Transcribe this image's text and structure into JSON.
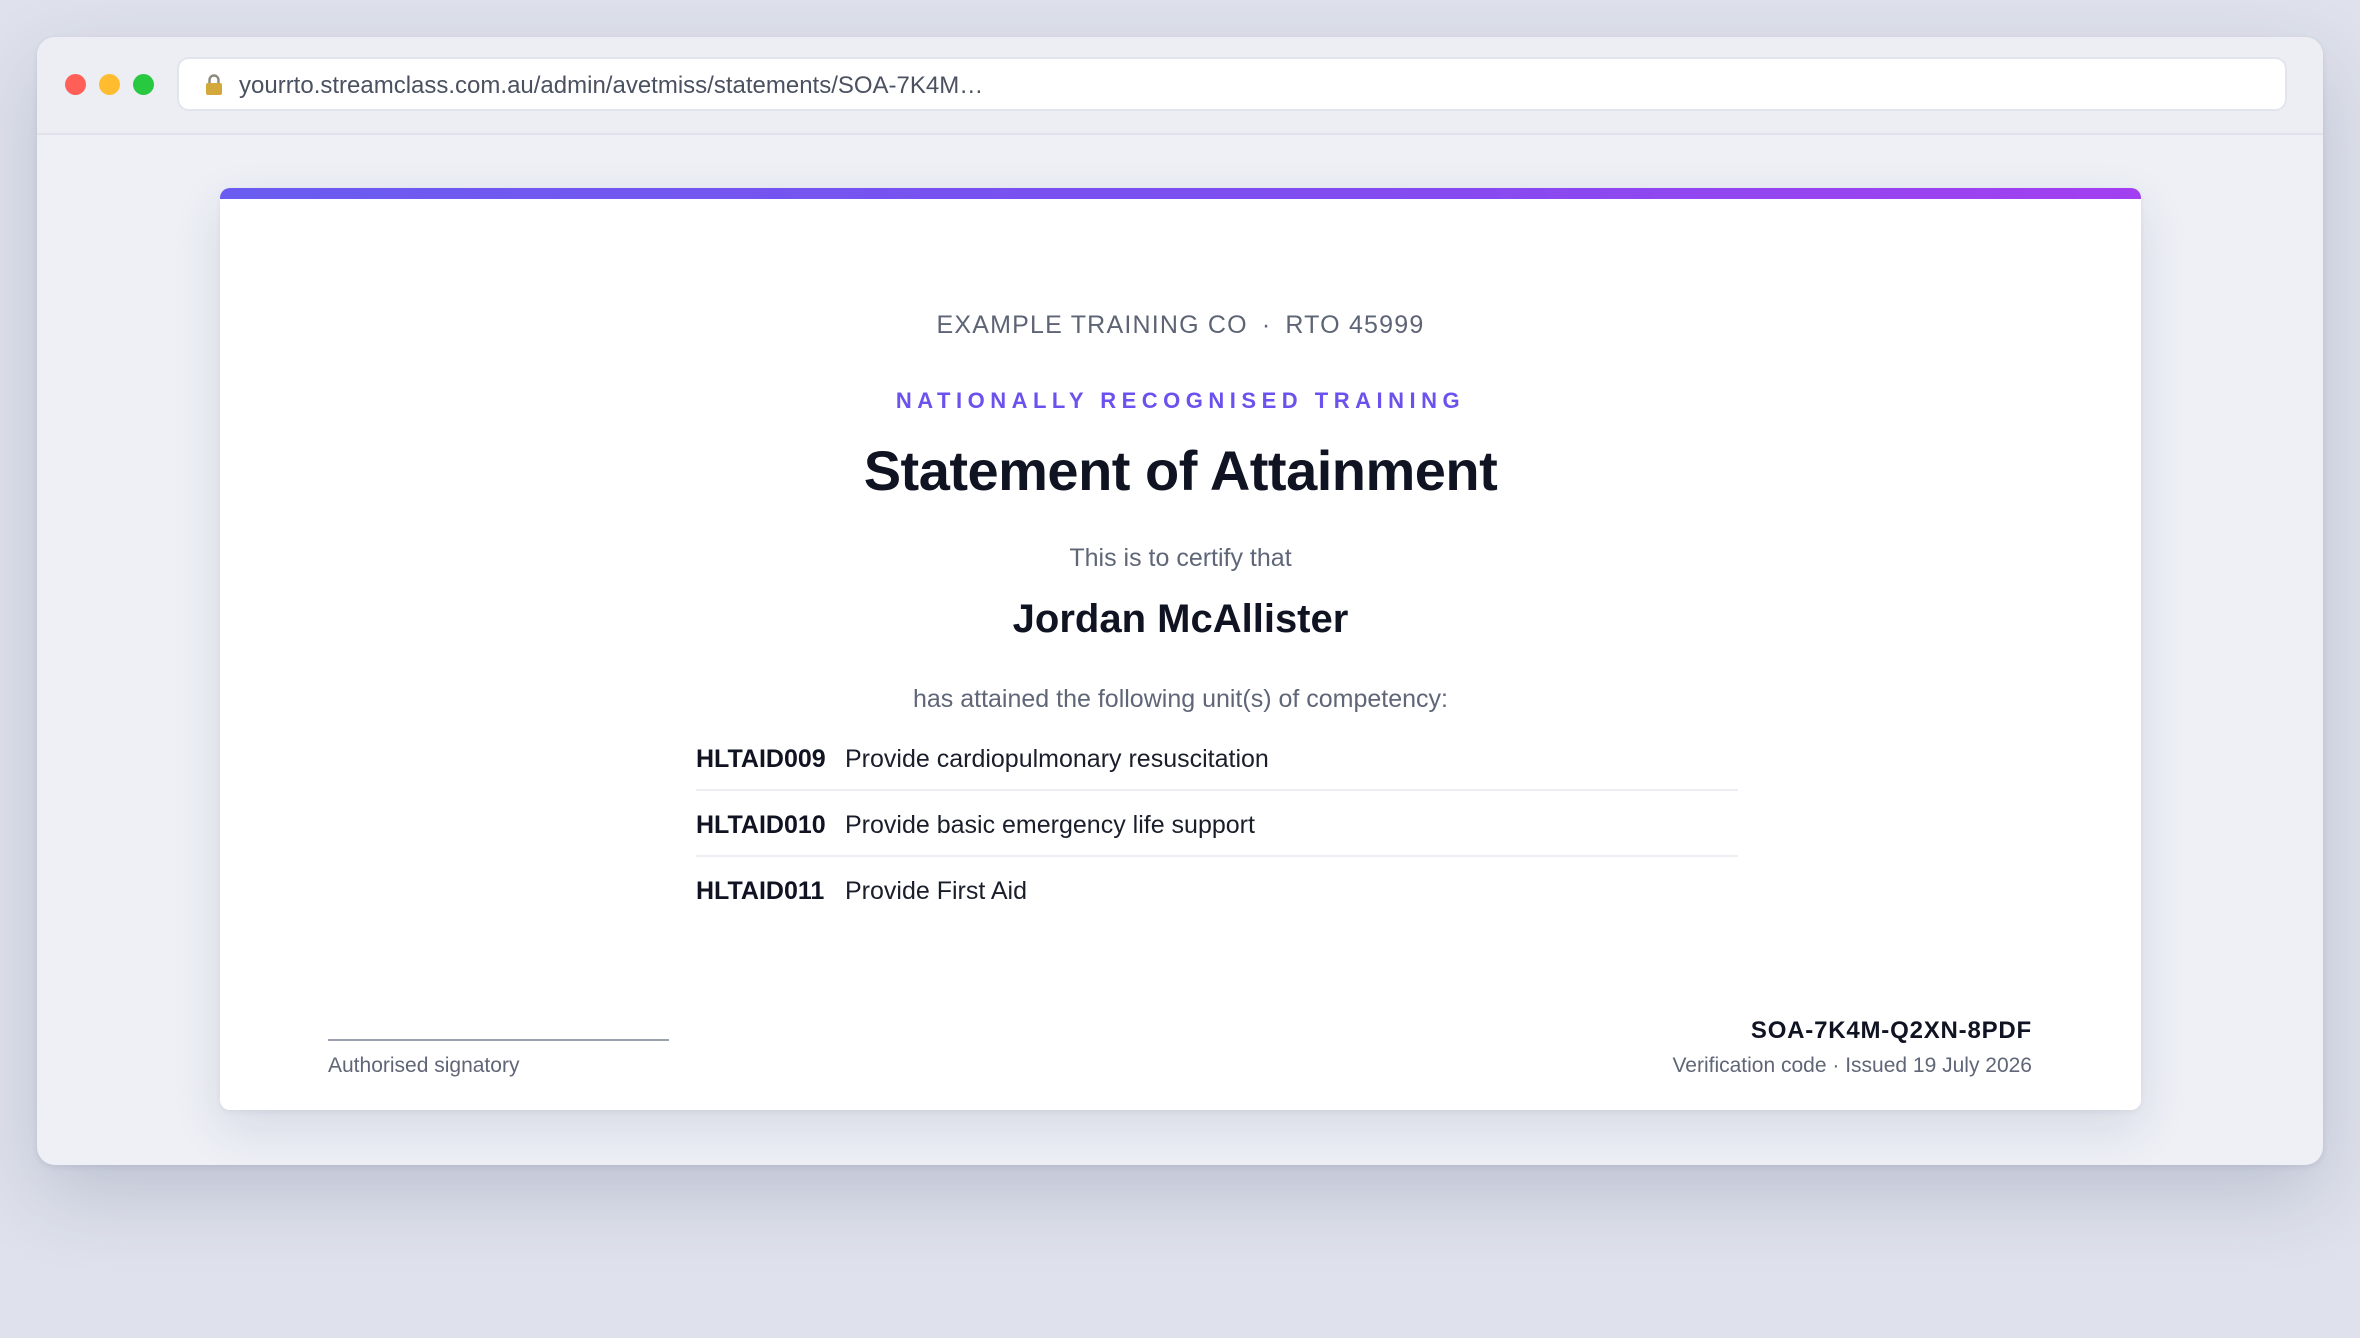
{
  "browser": {
    "url": "yourrto.streamclass.com.au/admin/avetmiss/statements/SOA-7K4M…",
    "lock_icon": "lock-icon"
  },
  "certificate": {
    "org_name": "EXAMPLE TRAINING CO",
    "separator": "·",
    "rto": "RTO 45999",
    "eyebrow": "NATIONALLY RECOGNISED TRAINING",
    "title": "Statement of Attainment",
    "certify_text": "This is to certify that",
    "recipient": "Jordan McAllister",
    "attained_text": "has attained the following unit(s) of competency:",
    "units": [
      {
        "code": "HLTAID009",
        "title": "Provide cardiopulmonary resuscitation"
      },
      {
        "code": "HLTAID010",
        "title": "Provide basic emergency life support"
      },
      {
        "code": "HLTAID011",
        "title": "Provide First Aid"
      }
    ],
    "signatory_label": "Authorised signatory",
    "verification_code": "SOA-7K4M-Q2XN-8PDF",
    "verification_meta": "Verification code · Issued 19 July 2026"
  },
  "colors": {
    "accent_start": "#6a5cf0",
    "accent_end": "#a23ff0",
    "eyebrow": "#6b52ee",
    "traffic_red": "#ff5f57",
    "traffic_yellow": "#febc2e",
    "traffic_green": "#28c840"
  }
}
